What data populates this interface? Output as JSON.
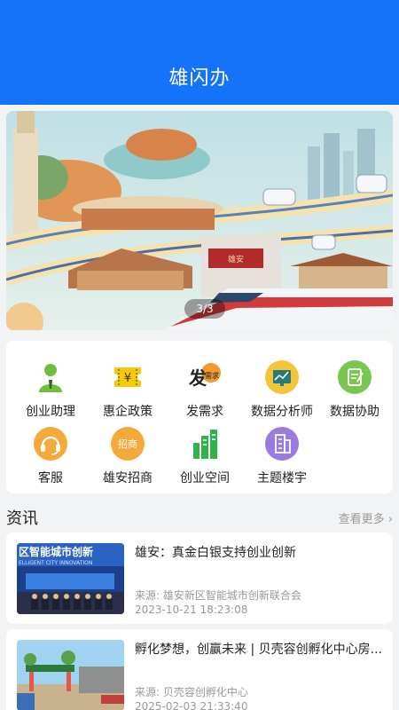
{
  "header": {
    "title": "雄闪办"
  },
  "banner": {
    "indicator": "3/3",
    "sign_text": "雄安"
  },
  "menu": {
    "items": [
      {
        "label": "创业助理",
        "icon": "user-assistant-icon",
        "color": "#6fbf3f"
      },
      {
        "label": "惠企政策",
        "icon": "ticket-yen-icon",
        "color": "#f6c80e"
      },
      {
        "label": "发需求",
        "icon": "post-demand-icon",
        "color": "#f29a2e",
        "icon_text_main": "发",
        "icon_text_sub": "需求"
      },
      {
        "label": "数据分析师",
        "icon": "chart-analysis-icon",
        "color": "#f4c43a"
      },
      {
        "label": "数据协助",
        "icon": "data-assist-icon",
        "color": "#7ac74f"
      },
      {
        "label": "客服",
        "icon": "headset-icon",
        "color": "#f6a93b"
      },
      {
        "label": "雄安招商",
        "icon": "investment-badge-icon",
        "color": "#f6a93b",
        "icon_text": "招商"
      },
      {
        "label": "创业空间",
        "icon": "building-bars-icon",
        "color": "#2fb34a"
      },
      {
        "label": "主题楼宇",
        "icon": "building-icon",
        "color": "#9b7be0"
      }
    ]
  },
  "news": {
    "header": "资讯",
    "more": "查看更多",
    "items": [
      {
        "title": "雄安：真金白银支持创业创新",
        "source": "来源: 雄安新区智能城市创新联合会",
        "time": "2023-10-21 18:23:08",
        "thumb_text_top": "区智能城市创新",
        "thumb_text_bottom": "ELLIGENT CITY INNOVATION"
      },
      {
        "title": "孵化梦想，创赢未来 | 贝壳容创孵化中心房...",
        "source": "来源: 贝壳容创孵化中心",
        "time": "2025-02-03 21:33:40"
      }
    ]
  }
}
